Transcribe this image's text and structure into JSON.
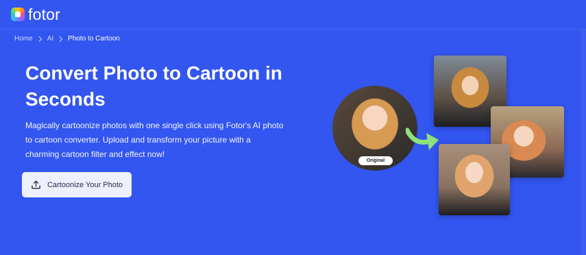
{
  "header": {
    "logo_text": "fotor",
    "logo_icon": "fotor-logo-icon"
  },
  "breadcrumb": {
    "items": [
      "Home",
      "AI",
      "Photo to Cartoon"
    ],
    "separator_icon": "chevron-right-icon"
  },
  "hero": {
    "title": "Convert Photo to Cartoon in Seconds",
    "description": "Magically cartoonize photos with one single click using Fotor's AI photo to cartoon converter. Upload and transform your picture with a charming cartoon filter and effect now!",
    "cta_label": "Cartoonize Your Photo",
    "cta_icon": "upload-icon"
  },
  "illustration": {
    "original_label": "Original",
    "arrow_icon": "curved-arrow-icon"
  },
  "colors": {
    "background": "#3355f0",
    "cta_background": "#eef0fc",
    "arrow": "#8ee07a"
  }
}
